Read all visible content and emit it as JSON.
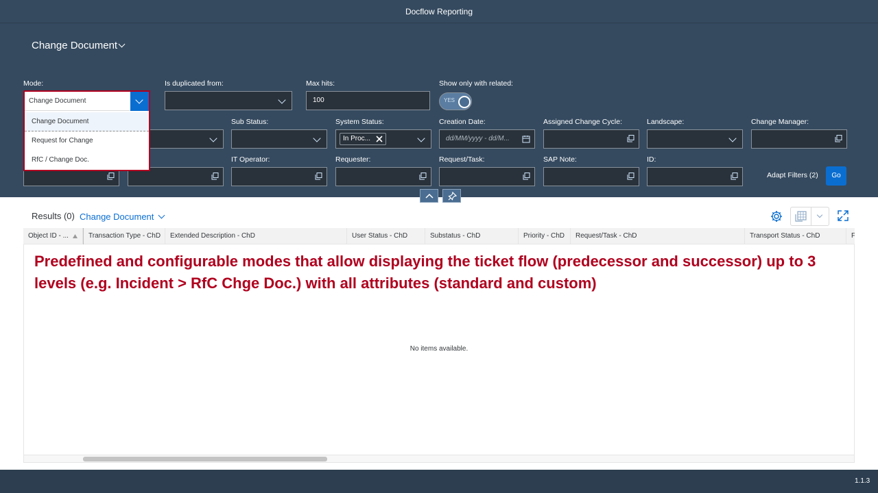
{
  "shell": {
    "title": "Docflow Reporting"
  },
  "variant": {
    "title": "Change Document"
  },
  "filters": {
    "mode": {
      "label": "Mode:",
      "value": "Change Document"
    },
    "is_duplicated_from": {
      "label": "Is duplicated from:",
      "value": ""
    },
    "max_hits": {
      "label": "Max hits:",
      "value": "100"
    },
    "show_only_related": {
      "label": "Show only with related:",
      "toggle_text": "YES",
      "on": true
    },
    "sub_status": {
      "label": "Sub Status:",
      "value": ""
    },
    "system_status": {
      "label": "System Status:",
      "token": "In Proc..."
    },
    "creation_date": {
      "label": "Creation Date:",
      "placeholder": "dd/MM/yyyy - dd/M..."
    },
    "assigned_change_cycle": {
      "label": "Assigned Change Cycle:",
      "value": ""
    },
    "landscape": {
      "label": "Landscape:",
      "value": ""
    },
    "change_manager": {
      "label": "Change Manager:",
      "value": ""
    },
    "it_operator": {
      "label": "IT Operator:",
      "value": ""
    },
    "requester": {
      "label": "Requester:",
      "value": ""
    },
    "request_task": {
      "label": "Request/Task:",
      "value": ""
    },
    "sap_note": {
      "label": "SAP Note:",
      "value": ""
    },
    "id": {
      "label": "ID:",
      "value": ""
    }
  },
  "dropdown": {
    "selected": "Change Document",
    "options": [
      "Change Document",
      "Request for Change",
      "RfC / Change Doc."
    ]
  },
  "actions": {
    "adapt_filters": "Adapt Filters (2)",
    "go": "Go"
  },
  "results": {
    "title": "Results (0)",
    "variant": "Change Document",
    "columns": [
      "Object ID - ...",
      "Transaction Type - ChD",
      "Extended Description - ChD",
      "User Status - ChD",
      "Substatus - ChD",
      "Priority - ChD",
      "Request/Task - ChD",
      "Transport Status - ChD",
      "F"
    ],
    "no_items": "No items available."
  },
  "annotation": "Predefined and configurable modes that allow displaying the ticket flow (predecessor and successor) up to 3 levels (e.g. Incident > RfC Chge Doc.) with all attributes (standard and custom)",
  "footer": {
    "version": "1.1.3"
  },
  "colors": {
    "shell": "#354a5f",
    "accent": "#0a6ed1",
    "annotation": "#b0001e",
    "footer": "#2c3e50"
  }
}
